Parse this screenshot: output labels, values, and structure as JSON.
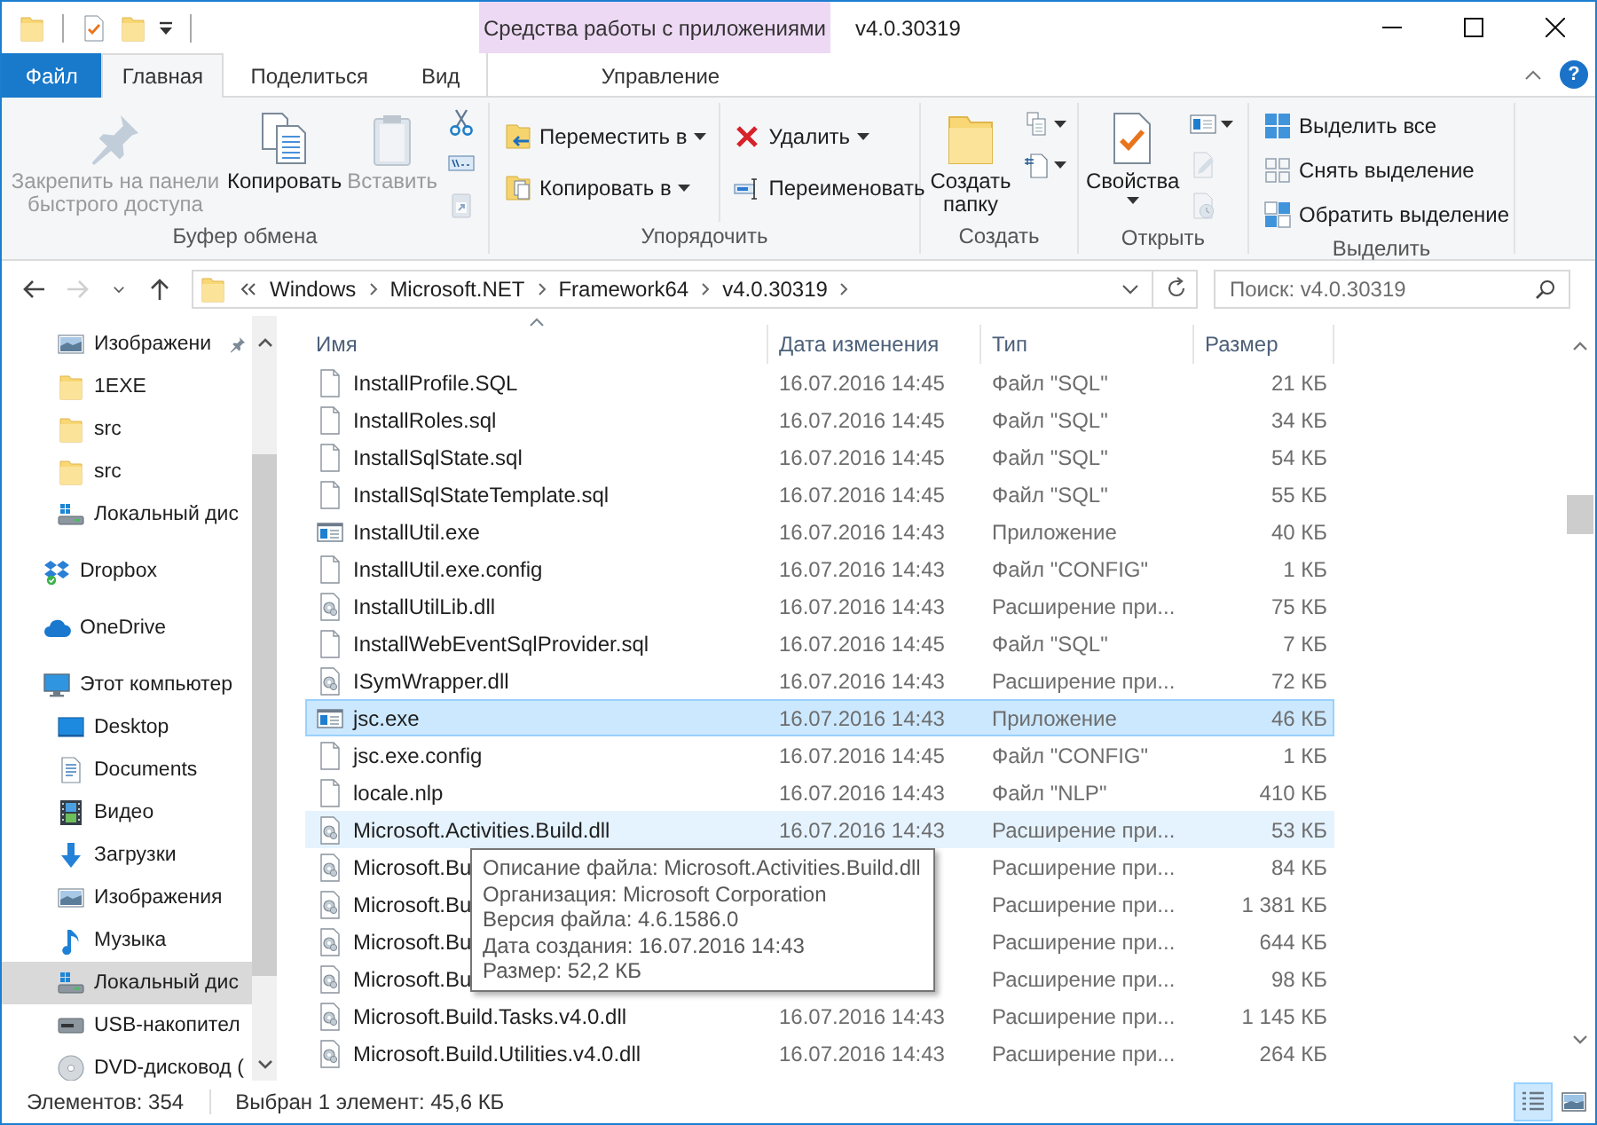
{
  "title_bar": {
    "contextual_label": "Средства работы с приложениями",
    "title": "v4.0.30319"
  },
  "tabs": [
    {
      "label": "Файл",
      "kind": "file",
      "selected": false
    },
    {
      "label": "Главная",
      "kind": "tab",
      "selected": true
    },
    {
      "label": "Поделиться",
      "kind": "tab",
      "selected": false
    },
    {
      "label": "Вид",
      "kind": "tab",
      "selected": false
    },
    {
      "label": "Управление",
      "kind": "contextual",
      "selected": false
    }
  ],
  "help_button": "?",
  "ribbon_groups": [
    {
      "label": "Буфер обмена",
      "columns": [
        [
          {
            "label": "Закрепить на панели быстрого доступа",
            "kind": "large",
            "disabled": true,
            "dropdown": false
          }
        ],
        [
          {
            "label": "Копировать",
            "kind": "large",
            "disabled": false,
            "dropdown": false
          }
        ],
        [
          {
            "label": "Вставить",
            "kind": "large",
            "disabled": true,
            "dropdown": false
          }
        ],
        [
          {
            "kind": "icon",
            "disabled": false,
            "dropdown": false
          },
          {
            "kind": "icon",
            "disabled": false,
            "dropdown": false
          },
          {
            "kind": "icon",
            "disabled": true,
            "dropdown": false
          }
        ]
      ]
    },
    {
      "label": "Упорядочить",
      "columns": [
        [
          {
            "label": "Переместить в",
            "kind": "small",
            "disabled": false,
            "dropdown": true
          },
          {
            "label": "Копировать в",
            "kind": "small",
            "disabled": false,
            "dropdown": true
          }
        ],
        [
          {
            "label": "Удалить",
            "kind": "small",
            "disabled": false,
            "dropdown": true
          },
          {
            "label": "Переименовать",
            "kind": "small",
            "disabled": false,
            "dropdown": false
          }
        ]
      ]
    },
    {
      "label": "Создать",
      "columns": [
        [
          {
            "label": "Создать папку",
            "kind": "large",
            "disabled": false,
            "dropdown": false
          }
        ],
        [
          {
            "kind": "icon",
            "disabled": false,
            "dropdown": true
          },
          {
            "kind": "icon",
            "disabled": false,
            "dropdown": true
          }
        ]
      ]
    },
    {
      "label": "Открыть",
      "columns": [
        [
          {
            "label": "Свойства",
            "kind": "large",
            "disabled": false,
            "dropdown": true
          }
        ],
        [
          {
            "kind": "icon",
            "disabled": false,
            "dropdown": true
          },
          {
            "kind": "icon",
            "disabled": true,
            "dropdown": false
          },
          {
            "kind": "icon",
            "disabled": true,
            "dropdown": false
          }
        ]
      ]
    },
    {
      "label": "Выделить",
      "columns": [
        [
          {
            "label": "Выделить все",
            "kind": "small",
            "disabled": false,
            "dropdown": false
          },
          {
            "label": "Снять выделение",
            "kind": "small",
            "disabled": false,
            "dropdown": false
          },
          {
            "label": "Обратить выделение",
            "kind": "small",
            "disabled": false,
            "dropdown": false
          }
        ]
      ]
    }
  ],
  "nav_buttons": [
    {
      "kind": "back",
      "disabled": false
    },
    {
      "kind": "forward",
      "disabled": true
    },
    {
      "kind": "recent",
      "disabled": false
    },
    {
      "kind": "up",
      "disabled": false
    }
  ],
  "breadcrumb": [
    "Windows",
    "Microsoft.NET",
    "Framework64",
    "v4.0.30319"
  ],
  "search": {
    "placeholder": "Поиск: v4.0.30319"
  },
  "sidebar": {
    "quick_access_items": [
      {
        "label": "Изображени",
        "kind": "picture",
        "pinned": true,
        "selected": false
      },
      {
        "label": "1EXE",
        "kind": "folder",
        "pinned": false,
        "selected": false
      },
      {
        "label": "src",
        "kind": "folder",
        "pinned": false,
        "selected": false
      },
      {
        "label": "src",
        "kind": "folder",
        "pinned": false,
        "selected": false
      },
      {
        "label": "Локальный дис",
        "kind": "drive",
        "pinned": false,
        "selected": false
      }
    ],
    "items": [
      {
        "label": "Dropbox",
        "kind": "dropbox",
        "selected": false
      },
      {
        "label": "OneDrive",
        "kind": "cloud",
        "selected": false
      },
      {
        "label": "Этот компьютер",
        "kind": "computer",
        "selected": false,
        "children": [
          {
            "label": "Desktop",
            "kind": "desktop",
            "selected": false
          },
          {
            "label": "Documents",
            "kind": "documents",
            "selected": false
          },
          {
            "label": "Видео",
            "kind": "video",
            "selected": false
          },
          {
            "label": "Загрузки",
            "kind": "downloads",
            "selected": false
          },
          {
            "label": "Изображения",
            "kind": "picture",
            "selected": false
          },
          {
            "label": "Музыка",
            "kind": "music",
            "selected": false
          },
          {
            "label": "Локальный дис",
            "kind": "drive",
            "selected": true
          },
          {
            "label": "USB-накопител",
            "kind": "usb",
            "selected": false
          },
          {
            "label": "DVD-дисковод (",
            "kind": "dvd",
            "selected": false
          }
        ]
      }
    ]
  },
  "table": {
    "columns": [
      {
        "label": "Имя",
        "sorted": true
      },
      {
        "label": "Дата изменения",
        "sorted": false
      },
      {
        "label": "Тип",
        "sorted": false
      },
      {
        "label": "Размер",
        "sorted": false
      }
    ],
    "rows": [
      {
        "name": "InstallProfile.SQL",
        "date": "16.07.2016 14:45",
        "type": "Файл \"SQL\"",
        "size": "21 КБ",
        "kind": "file",
        "selected": false,
        "hovered": false
      },
      {
        "name": "InstallRoles.sql",
        "date": "16.07.2016 14:45",
        "type": "Файл \"SQL\"",
        "size": "34 КБ",
        "kind": "file",
        "selected": false,
        "hovered": false
      },
      {
        "name": "InstallSqlState.sql",
        "date": "16.07.2016 14:45",
        "type": "Файл \"SQL\"",
        "size": "54 КБ",
        "kind": "file",
        "selected": false,
        "hovered": false
      },
      {
        "name": "InstallSqlStateTemplate.sql",
        "date": "16.07.2016 14:45",
        "type": "Файл \"SQL\"",
        "size": "55 КБ",
        "kind": "file",
        "selected": false,
        "hovered": false
      },
      {
        "name": "InstallUtil.exe",
        "date": "16.07.2016 14:43",
        "type": "Приложение",
        "size": "40 КБ",
        "kind": "exe",
        "selected": false,
        "hovered": false
      },
      {
        "name": "InstallUtil.exe.config",
        "date": "16.07.2016 14:43",
        "type": "Файл \"CONFIG\"",
        "size": "1 КБ",
        "kind": "file",
        "selected": false,
        "hovered": false
      },
      {
        "name": "InstallUtilLib.dll",
        "date": "16.07.2016 14:43",
        "type": "Расширение при...",
        "size": "75 КБ",
        "kind": "dll",
        "selected": false,
        "hovered": false
      },
      {
        "name": "InstallWebEventSqlProvider.sql",
        "date": "16.07.2016 14:45",
        "type": "Файл \"SQL\"",
        "size": "7 КБ",
        "kind": "file",
        "selected": false,
        "hovered": false
      },
      {
        "name": "ISymWrapper.dll",
        "date": "16.07.2016 14:43",
        "type": "Расширение при...",
        "size": "72 КБ",
        "kind": "dll",
        "selected": false,
        "hovered": false
      },
      {
        "name": "jsc.exe",
        "date": "16.07.2016 14:43",
        "type": "Приложение",
        "size": "46 КБ",
        "kind": "exe",
        "selected": true,
        "hovered": false
      },
      {
        "name": "jsc.exe.config",
        "date": "16.07.2016 14:45",
        "type": "Файл \"CONFIG\"",
        "size": "1 КБ",
        "kind": "file",
        "selected": false,
        "hovered": false
      },
      {
        "name": "locale.nlp",
        "date": "16.07.2016 14:43",
        "type": "Файл \"NLP\"",
        "size": "410 КБ",
        "kind": "file",
        "selected": false,
        "hovered": false
      },
      {
        "name": "Microsoft.Activities.Build.dll",
        "date": "16.07.2016 14:43",
        "type": "Расширение при...",
        "size": "53 КБ",
        "kind": "dll",
        "selected": false,
        "hovered": true
      },
      {
        "name": "Microsoft.Bu",
        "type": "Расширение при...",
        "size": "84 КБ",
        "kind": "dll",
        "selected": false,
        "hovered": false
      },
      {
        "name": "Microsoft.Bu",
        "type": "Расширение при...",
        "size": "1 381 КБ",
        "kind": "dll",
        "selected": false,
        "hovered": false
      },
      {
        "name": "Microsoft.Bu",
        "type": "Расширение при...",
        "size": "644 КБ",
        "kind": "dll",
        "selected": false,
        "hovered": false
      },
      {
        "name": "Microsoft.Bu",
        "type": "Расширение при...",
        "size": "98 КБ",
        "kind": "dll",
        "selected": false,
        "hovered": false
      },
      {
        "name": "Microsoft.Build.Tasks.v4.0.dll",
        "date": "16.07.2016 14:43",
        "type": "Расширение при...",
        "size": "1 145 КБ",
        "kind": "dll",
        "selected": false,
        "hovered": false
      },
      {
        "name": "Microsoft.Build.Utilities.v4.0.dll",
        "date": "16.07.2016 14:43",
        "type": "Расширение при...",
        "size": "264 КБ",
        "kind": "dll",
        "selected": false,
        "hovered": false
      }
    ]
  },
  "tooltip": {
    "lines": [
      "Описание файла: Microsoft.Activities.Build.dll",
      "Организация: Microsoft Corporation",
      "Версия файла: 4.6.1586.0",
      "Дата создания: 16.07.2016 14:43",
      "Размер: 52,2 КБ"
    ]
  },
  "status_bar": {
    "item_count": "Элементов: 354",
    "selection": "Выбран 1 элемент: 45,6 КБ"
  },
  "view_buttons": [
    {
      "kind": "details",
      "selected": true
    },
    {
      "kind": "large-icons",
      "selected": false
    }
  ]
}
